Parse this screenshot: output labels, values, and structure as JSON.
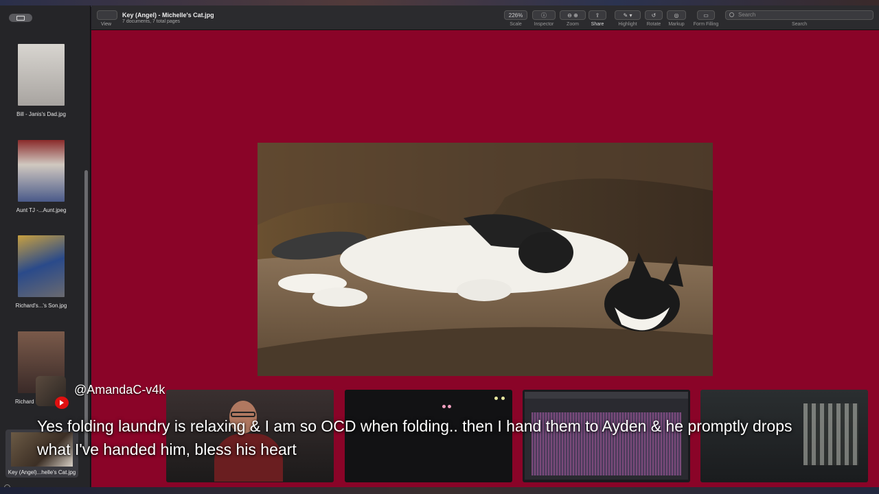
{
  "app": {
    "doc_title": "Key (Angel) - Michelle's Cat.jpg",
    "doc_subtitle": "7 documents, 7 total pages",
    "view_label": "View"
  },
  "toolbar": {
    "scale_value": "226%",
    "scale_label": "Scale",
    "inspector_label": "Inspector",
    "zoom_label": "Zoom",
    "share_label": "Share",
    "highlight_label": "Highlight",
    "rotate_label": "Rotate",
    "markup_label": "Markup",
    "form_filling_label": "Form Filling",
    "search_placeholder": "Search",
    "search_label": "Search"
  },
  "sidebar": {
    "items": [
      {
        "caption": "Bill - Janis's Dad.jpg"
      },
      {
        "caption": "Aunt TJ -...Aunt.jpeg"
      },
      {
        "caption": "Richard's...'s Son.jpg"
      },
      {
        "caption": "Richard"
      },
      {
        "caption": "Key (Angel)...helle's Cat.jpg"
      }
    ]
  },
  "overlay": {
    "handle": "@AmandaC-v4k",
    "message": "Yes folding laundry is relaxing & I am so OCD when folding.. then I hand them to Ayden & he promptly drops what I've handed him, bless his heart"
  },
  "colors": {
    "canvas_bg": "#8a0428",
    "sidebar_bg": "#252528",
    "toolbar_bg": "#2b2b2e",
    "youtube_red": "#e01010"
  },
  "icons": [
    "sidebar-toggle-icon",
    "view-icon",
    "inspector-icon",
    "zoom-out-icon",
    "zoom-in-icon",
    "share-icon",
    "highlight-icon",
    "rotate-icon",
    "markup-icon",
    "form-filling-icon",
    "search-icon",
    "youtube-icon"
  ]
}
